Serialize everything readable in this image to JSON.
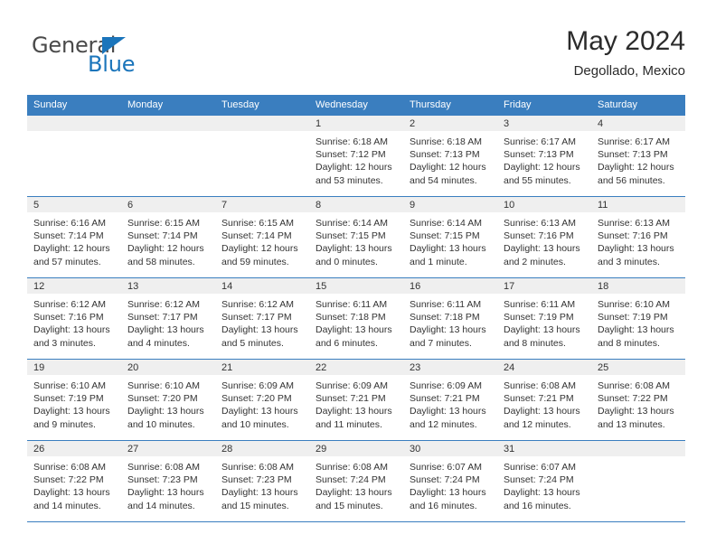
{
  "logo": {
    "word1": "General",
    "word2": "Blue",
    "triangle_color": "#1b75bb",
    "word1_color": "#4a4a4a"
  },
  "header": {
    "title": "May 2024",
    "subtitle": "Degollado, Mexico"
  },
  "theme": {
    "header_bg": "#3a7ebf",
    "header_text": "#ffffff",
    "day_band_bg": "#efefef",
    "grid_line": "#3a7ebf",
    "body_text": "#333333"
  },
  "weekdays": [
    "Sunday",
    "Monday",
    "Tuesday",
    "Wednesday",
    "Thursday",
    "Friday",
    "Saturday"
  ],
  "labels": {
    "sunrise": "Sunrise:",
    "sunset": "Sunset:",
    "daylight": "Daylight:"
  },
  "weeks": [
    [
      {
        "day": "",
        "empty": true
      },
      {
        "day": "",
        "empty": true
      },
      {
        "day": "",
        "empty": true
      },
      {
        "day": "1",
        "sunrise": "Sunrise: 6:18 AM",
        "sunset": "Sunset: 7:12 PM",
        "daylight_1": "Daylight: 12 hours",
        "daylight_2": "and 53 minutes."
      },
      {
        "day": "2",
        "sunrise": "Sunrise: 6:18 AM",
        "sunset": "Sunset: 7:13 PM",
        "daylight_1": "Daylight: 12 hours",
        "daylight_2": "and 54 minutes."
      },
      {
        "day": "3",
        "sunrise": "Sunrise: 6:17 AM",
        "sunset": "Sunset: 7:13 PM",
        "daylight_1": "Daylight: 12 hours",
        "daylight_2": "and 55 minutes."
      },
      {
        "day": "4",
        "sunrise": "Sunrise: 6:17 AM",
        "sunset": "Sunset: 7:13 PM",
        "daylight_1": "Daylight: 12 hours",
        "daylight_2": "and 56 minutes."
      }
    ],
    [
      {
        "day": "5",
        "sunrise": "Sunrise: 6:16 AM",
        "sunset": "Sunset: 7:14 PM",
        "daylight_1": "Daylight: 12 hours",
        "daylight_2": "and 57 minutes."
      },
      {
        "day": "6",
        "sunrise": "Sunrise: 6:15 AM",
        "sunset": "Sunset: 7:14 PM",
        "daylight_1": "Daylight: 12 hours",
        "daylight_2": "and 58 minutes."
      },
      {
        "day": "7",
        "sunrise": "Sunrise: 6:15 AM",
        "sunset": "Sunset: 7:14 PM",
        "daylight_1": "Daylight: 12 hours",
        "daylight_2": "and 59 minutes."
      },
      {
        "day": "8",
        "sunrise": "Sunrise: 6:14 AM",
        "sunset": "Sunset: 7:15 PM",
        "daylight_1": "Daylight: 13 hours",
        "daylight_2": "and 0 minutes."
      },
      {
        "day": "9",
        "sunrise": "Sunrise: 6:14 AM",
        "sunset": "Sunset: 7:15 PM",
        "daylight_1": "Daylight: 13 hours",
        "daylight_2": "and 1 minute."
      },
      {
        "day": "10",
        "sunrise": "Sunrise: 6:13 AM",
        "sunset": "Sunset: 7:16 PM",
        "daylight_1": "Daylight: 13 hours",
        "daylight_2": "and 2 minutes."
      },
      {
        "day": "11",
        "sunrise": "Sunrise: 6:13 AM",
        "sunset": "Sunset: 7:16 PM",
        "daylight_1": "Daylight: 13 hours",
        "daylight_2": "and 3 minutes."
      }
    ],
    [
      {
        "day": "12",
        "sunrise": "Sunrise: 6:12 AM",
        "sunset": "Sunset: 7:16 PM",
        "daylight_1": "Daylight: 13 hours",
        "daylight_2": "and 3 minutes."
      },
      {
        "day": "13",
        "sunrise": "Sunrise: 6:12 AM",
        "sunset": "Sunset: 7:17 PM",
        "daylight_1": "Daylight: 13 hours",
        "daylight_2": "and 4 minutes."
      },
      {
        "day": "14",
        "sunrise": "Sunrise: 6:12 AM",
        "sunset": "Sunset: 7:17 PM",
        "daylight_1": "Daylight: 13 hours",
        "daylight_2": "and 5 minutes."
      },
      {
        "day": "15",
        "sunrise": "Sunrise: 6:11 AM",
        "sunset": "Sunset: 7:18 PM",
        "daylight_1": "Daylight: 13 hours",
        "daylight_2": "and 6 minutes."
      },
      {
        "day": "16",
        "sunrise": "Sunrise: 6:11 AM",
        "sunset": "Sunset: 7:18 PM",
        "daylight_1": "Daylight: 13 hours",
        "daylight_2": "and 7 minutes."
      },
      {
        "day": "17",
        "sunrise": "Sunrise: 6:11 AM",
        "sunset": "Sunset: 7:19 PM",
        "daylight_1": "Daylight: 13 hours",
        "daylight_2": "and 8 minutes."
      },
      {
        "day": "18",
        "sunrise": "Sunrise: 6:10 AM",
        "sunset": "Sunset: 7:19 PM",
        "daylight_1": "Daylight: 13 hours",
        "daylight_2": "and 8 minutes."
      }
    ],
    [
      {
        "day": "19",
        "sunrise": "Sunrise: 6:10 AM",
        "sunset": "Sunset: 7:19 PM",
        "daylight_1": "Daylight: 13 hours",
        "daylight_2": "and 9 minutes."
      },
      {
        "day": "20",
        "sunrise": "Sunrise: 6:10 AM",
        "sunset": "Sunset: 7:20 PM",
        "daylight_1": "Daylight: 13 hours",
        "daylight_2": "and 10 minutes."
      },
      {
        "day": "21",
        "sunrise": "Sunrise: 6:09 AM",
        "sunset": "Sunset: 7:20 PM",
        "daylight_1": "Daylight: 13 hours",
        "daylight_2": "and 10 minutes."
      },
      {
        "day": "22",
        "sunrise": "Sunrise: 6:09 AM",
        "sunset": "Sunset: 7:21 PM",
        "daylight_1": "Daylight: 13 hours",
        "daylight_2": "and 11 minutes."
      },
      {
        "day": "23",
        "sunrise": "Sunrise: 6:09 AM",
        "sunset": "Sunset: 7:21 PM",
        "daylight_1": "Daylight: 13 hours",
        "daylight_2": "and 12 minutes."
      },
      {
        "day": "24",
        "sunrise": "Sunrise: 6:08 AM",
        "sunset": "Sunset: 7:21 PM",
        "daylight_1": "Daylight: 13 hours",
        "daylight_2": "and 12 minutes."
      },
      {
        "day": "25",
        "sunrise": "Sunrise: 6:08 AM",
        "sunset": "Sunset: 7:22 PM",
        "daylight_1": "Daylight: 13 hours",
        "daylight_2": "and 13 minutes."
      }
    ],
    [
      {
        "day": "26",
        "sunrise": "Sunrise: 6:08 AM",
        "sunset": "Sunset: 7:22 PM",
        "daylight_1": "Daylight: 13 hours",
        "daylight_2": "and 14 minutes."
      },
      {
        "day": "27",
        "sunrise": "Sunrise: 6:08 AM",
        "sunset": "Sunset: 7:23 PM",
        "daylight_1": "Daylight: 13 hours",
        "daylight_2": "and 14 minutes."
      },
      {
        "day": "28",
        "sunrise": "Sunrise: 6:08 AM",
        "sunset": "Sunset: 7:23 PM",
        "daylight_1": "Daylight: 13 hours",
        "daylight_2": "and 15 minutes."
      },
      {
        "day": "29",
        "sunrise": "Sunrise: 6:08 AM",
        "sunset": "Sunset: 7:24 PM",
        "daylight_1": "Daylight: 13 hours",
        "daylight_2": "and 15 minutes."
      },
      {
        "day": "30",
        "sunrise": "Sunrise: 6:07 AM",
        "sunset": "Sunset: 7:24 PM",
        "daylight_1": "Daylight: 13 hours",
        "daylight_2": "and 16 minutes."
      },
      {
        "day": "31",
        "sunrise": "Sunrise: 6:07 AM",
        "sunset": "Sunset: 7:24 PM",
        "daylight_1": "Daylight: 13 hours",
        "daylight_2": "and 16 minutes."
      },
      {
        "day": "",
        "empty": true
      }
    ]
  ]
}
